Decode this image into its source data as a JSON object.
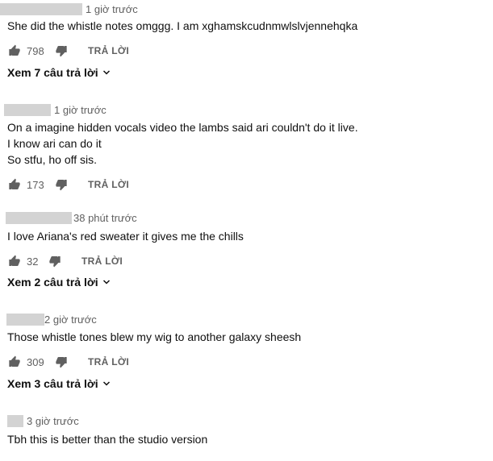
{
  "comments": [
    {
      "time": "1 giờ trước",
      "lines": [
        "She did the whistle notes omggg. I am xghamskcudnmwlslvjennehqka"
      ],
      "likes": "798",
      "reply_label": "TRẢ LỜI",
      "view_replies": "Xem 7 câu trả lời"
    },
    {
      "time": "1 giờ trước",
      "lines": [
        "On a  imagine hidden vocals video the lambs said ari couldn't do it live.",
        "I know ari can do it",
        "So stfu, ho off sis."
      ],
      "likes": "173",
      "reply_label": "TRẢ LỜI"
    },
    {
      "time": "38 phút trước",
      "lines": [
        "I love Ariana's red sweater it gives me the chills"
      ],
      "likes": "32",
      "reply_label": "TRẢ LỜI",
      "view_replies": "Xem 2 câu trả lời"
    },
    {
      "time": "2 giờ trước",
      "lines": [
        "Those whistle tones blew my wig to another galaxy sheesh"
      ],
      "likes": "309",
      "reply_label": "TRẢ LỜI",
      "view_replies": "Xem 3 câu trả lời"
    },
    {
      "time": "3 giờ trước",
      "lines": [
        "Tbh this is better than the studio version"
      ]
    }
  ],
  "icons": {
    "like": "thumbs-up-icon",
    "dislike": "thumbs-down-icon",
    "expand": "chevron-down-icon"
  },
  "colors": {
    "redacted_name": "#d3d3d3",
    "meta_text": "#606060",
    "body_text": "#0f0f0f"
  }
}
